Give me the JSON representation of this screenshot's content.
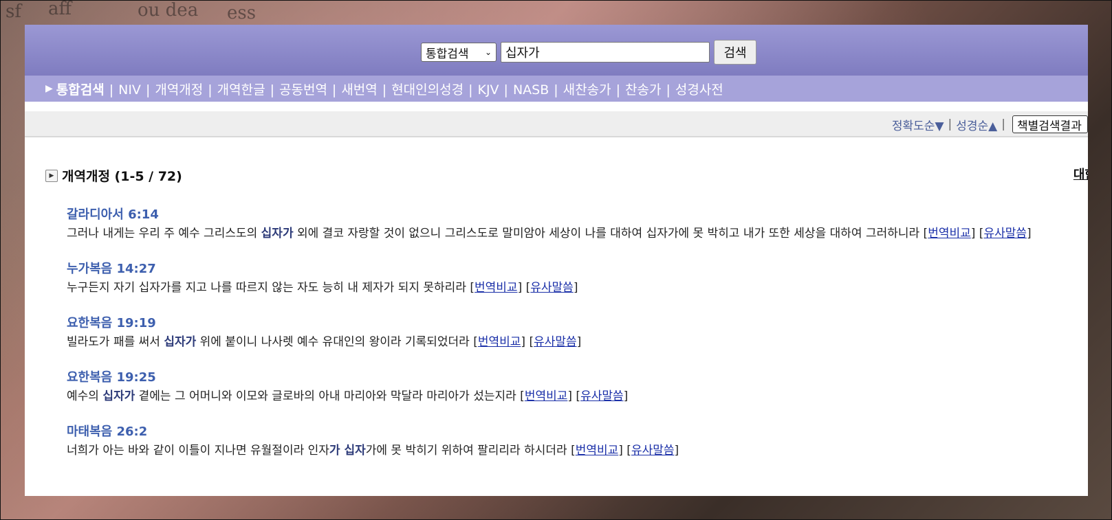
{
  "header": {
    "search_type": "통합검색",
    "search_value": "십자가",
    "search_button": "검색"
  },
  "nav": {
    "items": [
      "통합검색",
      "NIV",
      "개역개정",
      "개역한글",
      "공동번역",
      "새번역",
      "현대인의성경",
      "KJV",
      "NASB",
      "새찬송가",
      "찬송가",
      "성경사전"
    ]
  },
  "sort": {
    "accuracy": "정확도순▼",
    "bible_order": "성경순▲",
    "book_select": "책별검색결과"
  },
  "section": {
    "title": "개역개정 (1-5 / 72)",
    "right_link": "대한"
  },
  "links": {
    "compare": "번역비교",
    "similar": "유사말씀"
  },
  "results": [
    {
      "ref": "갈라디아서 6:14",
      "pre": "그러나 내게는 우리 주 예수 그리스도의 ",
      "kw": "십자가",
      "post": " 외에 결코 자랑할 것이 없으니 그리스도로 말미암아 세상이 나를 대하여 십자가에 못 박히고 내가 또한 세상을 대하여 그러하니라 "
    },
    {
      "ref": "누가복음 14:27",
      "pre": "누구든지 자기 십자가를 지고 나를 따르지 않는 자도 능히 내 제자가 되지 못하리라 ",
      "kw": "",
      "post": ""
    },
    {
      "ref": "요한복음 19:19",
      "pre": "빌라도가 패를 써서 ",
      "kw": "십자가",
      "post": " 위에 붙이니 나사렛 예수 유대인의 왕이라 기록되었더라 "
    },
    {
      "ref": "요한복음 19:25",
      "pre": "예수의 ",
      "kw": "십자가",
      "post": " 곁에는 그 어머니와 이모와 글로바의 아내 마리아와 막달라 마리아가 섰는지라 "
    },
    {
      "ref": "마태복음 26:2",
      "pre": "너희가 아는 바와 같이 이틀이 지나면 유월절이라 인자",
      "kw": "가 십자",
      "post": "가에 못 박히기 위하여 팔리리라 하시더라 "
    }
  ]
}
